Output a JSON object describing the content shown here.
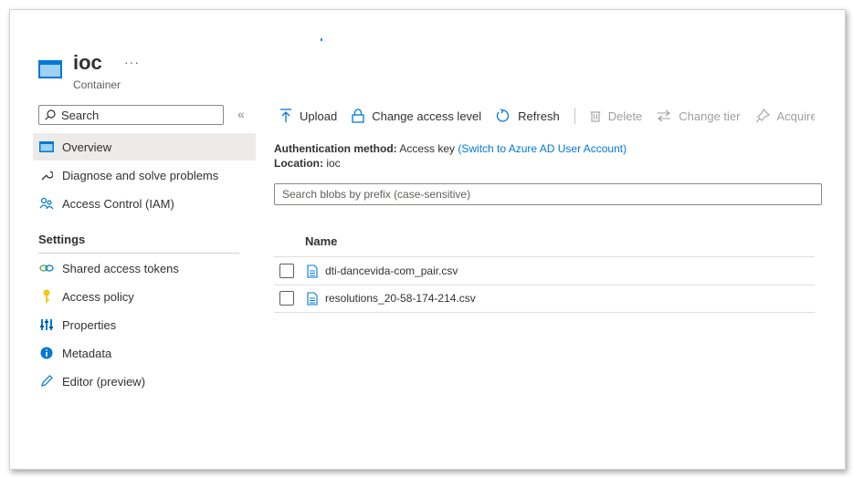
{
  "header": {
    "title": "ioc",
    "subtitle": "Container",
    "more_label": "···"
  },
  "sidebar": {
    "search_placeholder": "Search",
    "collapse_label": "«",
    "items": [
      {
        "label": "Overview",
        "icon": "overview-icon"
      },
      {
        "label": "Diagnose and solve problems",
        "icon": "wrench-icon"
      },
      {
        "label": "Access Control (IAM)",
        "icon": "people-icon"
      }
    ],
    "settings_label": "Settings",
    "settings_items": [
      {
        "label": "Shared access tokens",
        "icon": "link-icon"
      },
      {
        "label": "Access policy",
        "icon": "key-icon"
      },
      {
        "label": "Properties",
        "icon": "properties-icon"
      },
      {
        "label": "Metadata",
        "icon": "info-icon"
      },
      {
        "label": "Editor (preview)",
        "icon": "pencil-icon"
      }
    ]
  },
  "toolbar": {
    "upload": "Upload",
    "change_access": "Change access level",
    "refresh": "Refresh",
    "delete": "Delete",
    "change_tier": "Change tier",
    "acquire_lease": "Acquire lease"
  },
  "info": {
    "auth_label": "Authentication method:",
    "auth_value": "Access key",
    "auth_link": "(Switch to Azure AD User Account)",
    "location_label": "Location:",
    "location_value": "ioc"
  },
  "blob_search_placeholder": "Search blobs by prefix (case-sensitive)",
  "table": {
    "column_name": "Name",
    "rows": [
      {
        "name": "dti-dancevida-com_pair.csv"
      },
      {
        "name": "resolutions_20-58-174-214.csv"
      }
    ]
  },
  "colors": {
    "accent": "#0078d4",
    "active_bg": "#edebe9"
  }
}
